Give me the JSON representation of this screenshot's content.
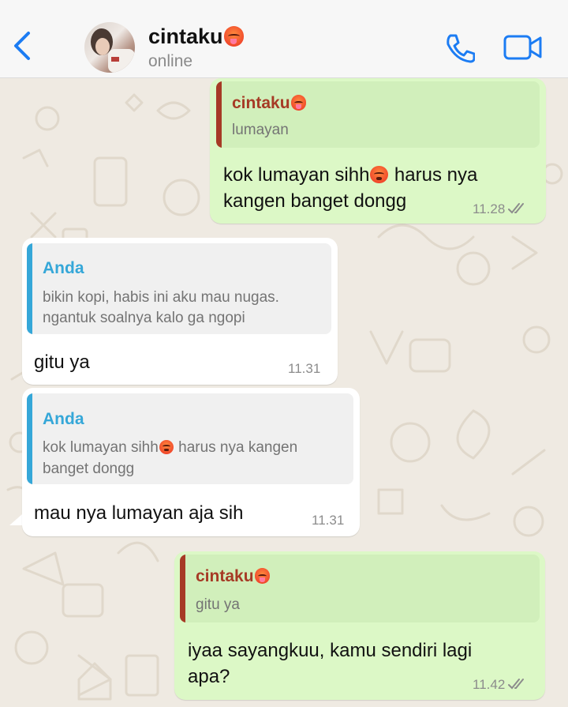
{
  "colors": {
    "background": "#efeae2",
    "outgoing_bubble": "#dcf8c6",
    "incoming_bubble": "#ffffff",
    "accent_blue": "#1c7cf3",
    "quote_contact": "#a63a25",
    "quote_self": "#35a7d8"
  },
  "header": {
    "back_icon": "chevron-left-icon",
    "contact_name": "cintaku",
    "status": "online",
    "call_icon": "phone-icon",
    "video_icon": "video-camera-icon"
  },
  "messages": [
    {
      "direction": "outgoing",
      "quote": {
        "author": "cintaku",
        "text": "lumayan"
      },
      "text_a": "kok lumayan sihh",
      "text_b": "harus nya",
      "text_c": "kangen banget dongg",
      "time": "11.28",
      "status": "read"
    },
    {
      "direction": "incoming",
      "quote": {
        "author": "Anda",
        "line1": "bikin kopi, habis ini aku mau nugas.",
        "line2": "ngantuk soalnya kalo ga ngopi"
      },
      "text": "gitu ya",
      "time": "11.31"
    },
    {
      "direction": "incoming",
      "quote": {
        "author": "Anda",
        "text_a": "kok lumayan sihh",
        "text_b": "harus nya kangen",
        "line2": "banget dongg"
      },
      "text": "mau nya lumayan aja sih",
      "time": "11.31"
    },
    {
      "direction": "outgoing",
      "quote": {
        "author": "cintaku",
        "text": "gitu ya"
      },
      "text_line1": "iyaa sayangkuu, kamu sendiri lagi",
      "text_line2": "apa?",
      "time": "11.42",
      "status": "read"
    }
  ]
}
